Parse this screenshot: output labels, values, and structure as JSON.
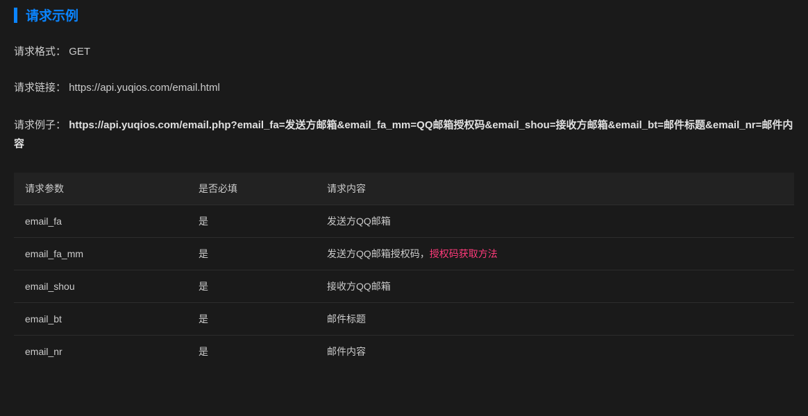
{
  "section": {
    "title": "请求示例"
  },
  "request": {
    "format_label": "请求格式：",
    "format_value": "GET",
    "url_label": "请求链接：",
    "url_value": "https://api.yuqios.com/email.html",
    "example_label": "请求例子：",
    "example_value": "https://api.yuqios.com/email.php?email_fa=发送方邮箱&email_fa_mm=QQ邮箱授权码&email_shou=接收方邮箱&email_bt=邮件标题&email_nr=邮件内容"
  },
  "table": {
    "headers": {
      "param": "请求参数",
      "required": "是否必填",
      "content": "请求内容"
    },
    "rows": [
      {
        "param": "email_fa",
        "required": "是",
        "content": "发送方QQ邮箱",
        "link": ""
      },
      {
        "param": "email_fa_mm",
        "required": "是",
        "content": "发送方QQ邮箱授权码，",
        "link": "授权码获取方法"
      },
      {
        "param": "email_shou",
        "required": "是",
        "content": "接收方QQ邮箱",
        "link": ""
      },
      {
        "param": "email_bt",
        "required": "是",
        "content": "邮件标题",
        "link": ""
      },
      {
        "param": "email_nr",
        "required": "是",
        "content": "邮件内容",
        "link": ""
      }
    ]
  }
}
